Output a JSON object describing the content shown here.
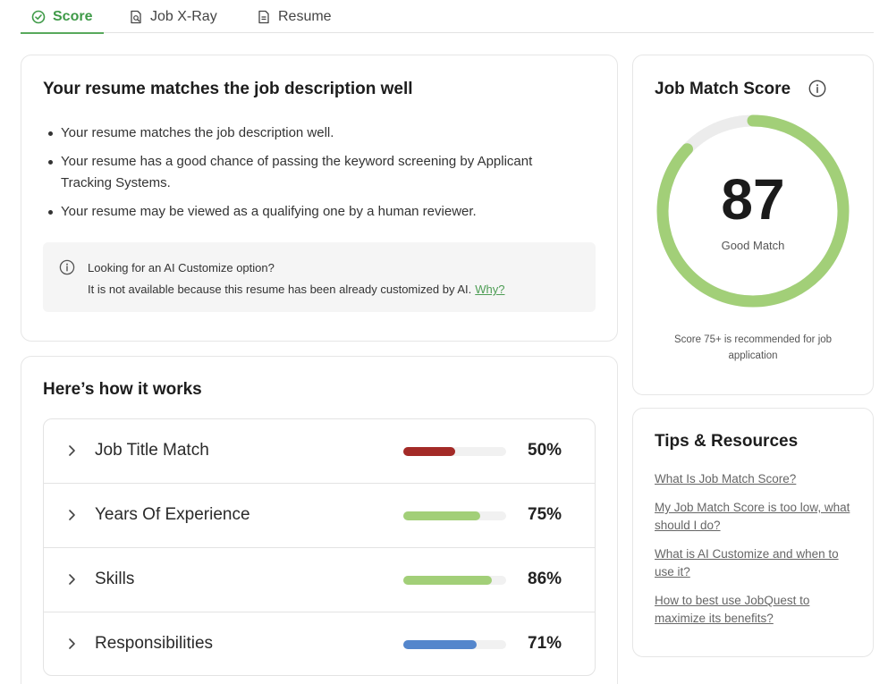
{
  "tabs": [
    {
      "label": "Score",
      "icon": "check-circle-icon",
      "active": true
    },
    {
      "label": "Job X-Ray",
      "icon": "document-search-icon",
      "active": false
    },
    {
      "label": "Resume",
      "icon": "document-icon",
      "active": false
    }
  ],
  "summary": {
    "title": "Your resume matches the job description well",
    "bullets": [
      "Your resume matches the job description well.",
      "Your resume has a good chance of passing the keyword screening by Applicant Tracking Systems.",
      "Your resume may be viewed as a qualifying one by a human reviewer."
    ],
    "notice": {
      "heading": "Looking for an AI Customize option?",
      "text": "It is not available because this resume has been already customized by AI.",
      "link": "Why?"
    }
  },
  "how_it_works": {
    "title": "Here’s how it works",
    "metrics": [
      {
        "label": "Job Title Match",
        "percent": 50,
        "percent_label": "50%",
        "color": "#a32a27"
      },
      {
        "label": "Years Of Experience",
        "percent": 75,
        "percent_label": "75%",
        "color": "#a2cf78"
      },
      {
        "label": "Skills",
        "percent": 86,
        "percent_label": "86%",
        "color": "#a2cf78"
      },
      {
        "label": "Responsibilities",
        "percent": 71,
        "percent_label": "71%",
        "color": "#5486cc"
      }
    ]
  },
  "score": {
    "title": "Job Match Score",
    "value": 87,
    "value_label": "87",
    "status": "Good Match",
    "recommendation": "Score 75+ is recommended for job application",
    "gauge_color": "#a2cf78",
    "track_color": "#ececec"
  },
  "tips": {
    "title": "Tips & Resources",
    "links": [
      "What Is Job Match Score?",
      "My Job Match Score is too low, what should I do?",
      "What is AI Customize and when to use it?",
      "How to best use JobQuest to maximize its benefits?"
    ]
  }
}
